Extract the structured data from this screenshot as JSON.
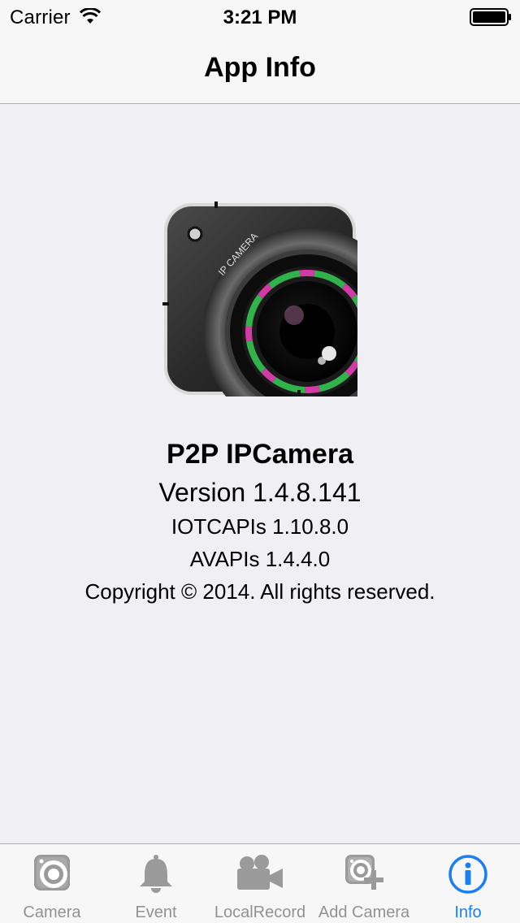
{
  "status_bar": {
    "carrier": "Carrier",
    "time": "3:21 PM"
  },
  "nav": {
    "title": "App Info"
  },
  "app_icon": {
    "label": "IP CAMERA"
  },
  "info": {
    "app_name": "P2P IPCamera",
    "version": "Version 1.4.8.141",
    "iotc": "IOTCAPIs 1.10.8.0",
    "av": "AVAPIs 1.4.4.0",
    "copyright": "Copyright © 2014. All rights reserved."
  },
  "tab_bar": {
    "active_color": "#1a7ef5",
    "inactive_color": "#929292",
    "tabs": [
      {
        "label": "Camera",
        "icon": "camera-icon"
      },
      {
        "label": "Event",
        "icon": "bell-icon"
      },
      {
        "label": "LocalRecord",
        "icon": "video-camera-icon"
      },
      {
        "label": "Add Camera",
        "icon": "add-camera-icon"
      },
      {
        "label": "Info",
        "icon": "info-icon",
        "active": true
      }
    ]
  }
}
